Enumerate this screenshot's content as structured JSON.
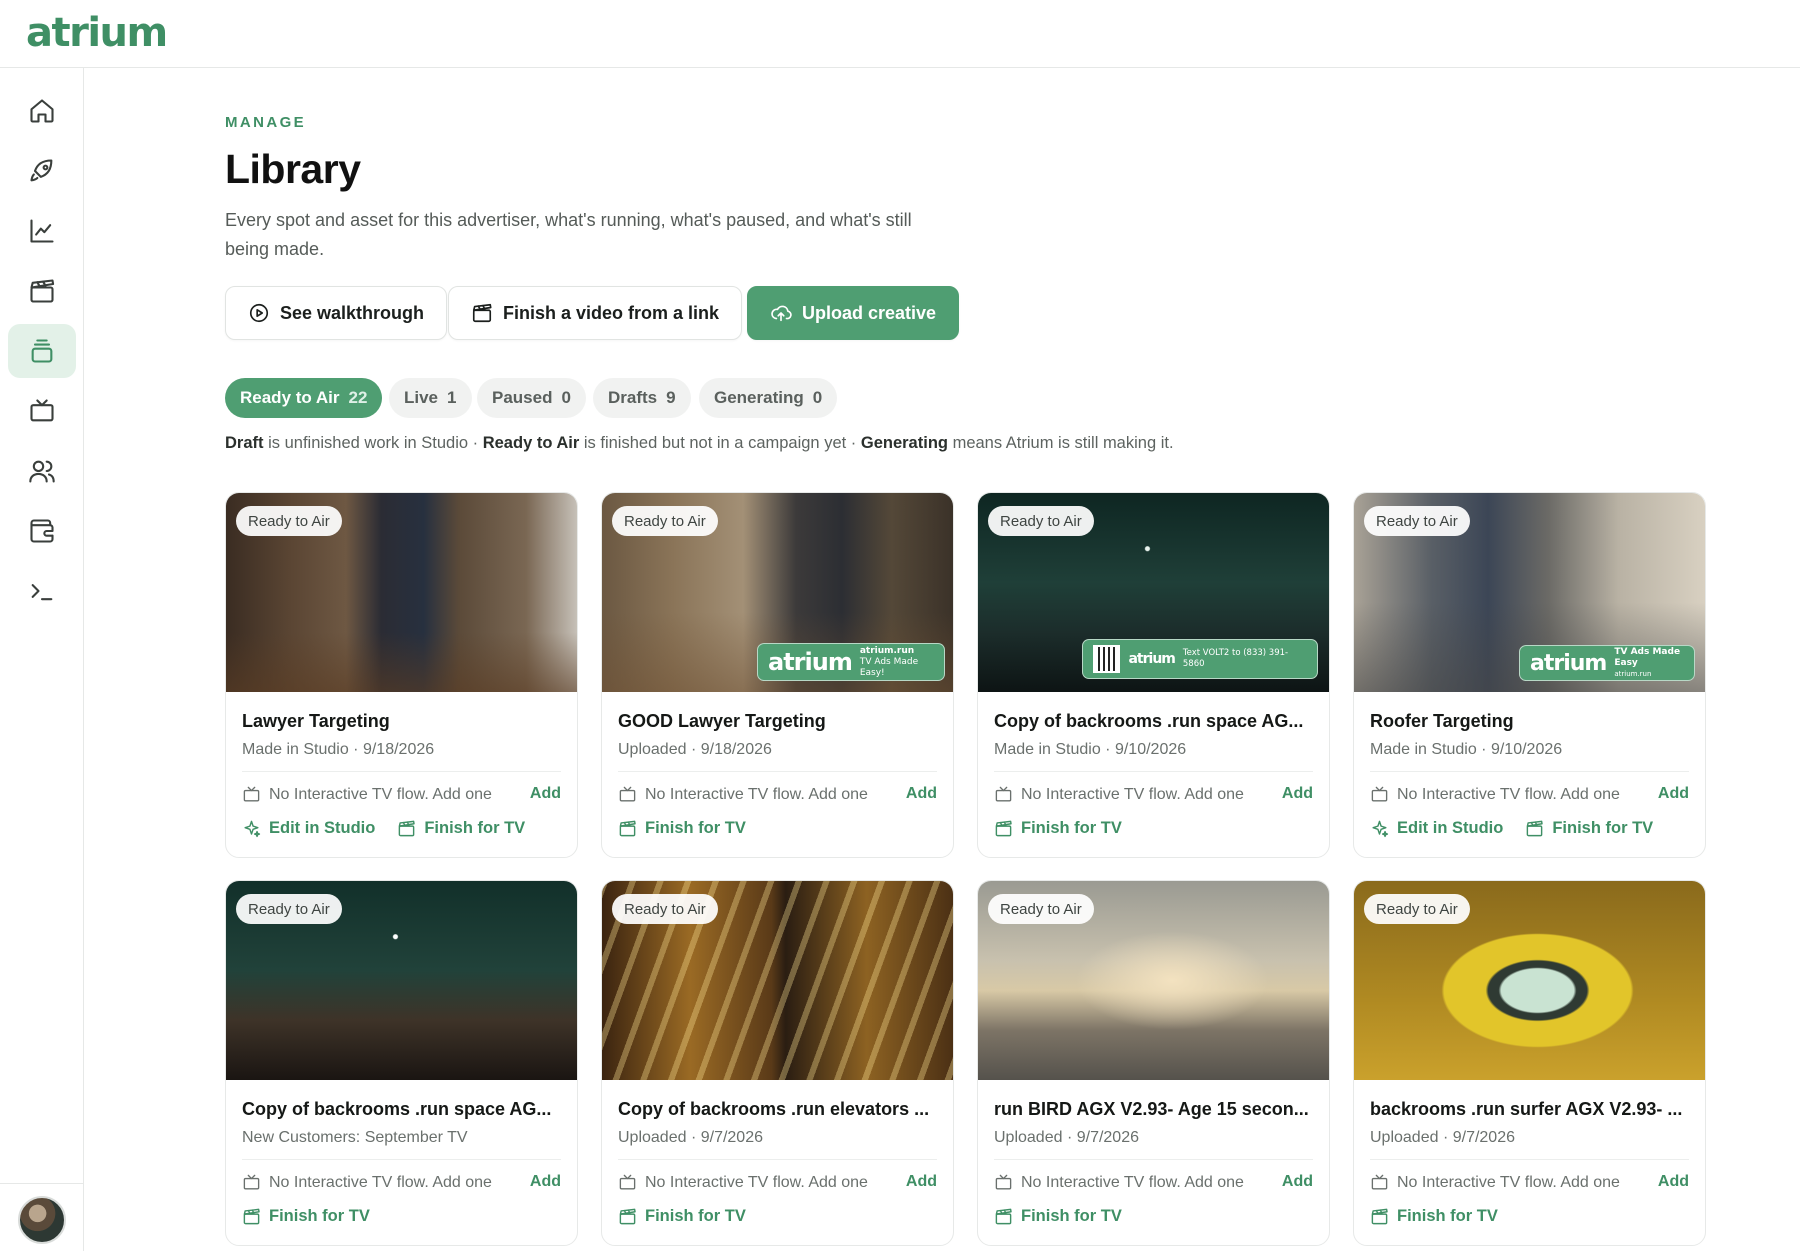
{
  "brand": {
    "logo_text": "atrium",
    "accent": "#4f9e72"
  },
  "sidebar": {
    "items": [
      {
        "icon": "home-icon",
        "active": false
      },
      {
        "icon": "rocket-icon",
        "active": false
      },
      {
        "icon": "chart-line-icon",
        "active": false
      },
      {
        "icon": "clapperboard-icon",
        "active": false
      },
      {
        "icon": "library-stack-icon",
        "active": true
      },
      {
        "icon": "tv-icon",
        "active": false
      },
      {
        "icon": "users-icon",
        "active": false
      },
      {
        "icon": "wallet-icon",
        "active": false
      },
      {
        "icon": "terminal-icon",
        "active": false
      }
    ]
  },
  "header": {
    "eyebrow": "MANAGE",
    "title": "Library",
    "description": "Every spot and asset for this advertiser, what's running, what's paused, and what's still being made."
  },
  "buttons": {
    "walkthrough": "See walkthrough",
    "finish_link": "Finish a video from a link",
    "upload": "Upload creative"
  },
  "filters": [
    {
      "label": "Ready to Air",
      "count": "22",
      "active": true
    },
    {
      "label": "Live",
      "count": "1",
      "active": false
    },
    {
      "label": "Paused",
      "count": "0",
      "active": false
    },
    {
      "label": "Drafts",
      "count": "9",
      "active": false
    },
    {
      "label": "Generating",
      "count": "0",
      "active": false
    }
  ],
  "legend": {
    "draft_term": "Draft",
    "draft_text": " is unfinished work in Studio · ",
    "ready_term": "Ready to Air",
    "ready_text": " is finished but not in a campaign yet · ",
    "generating_term": "Generating",
    "generating_text": " means Atrium is still making it."
  },
  "overlays": {
    "brand": "atrium",
    "c2_url": "atrium.run",
    "c2_tag": "TV Ads Made Easy!",
    "c3_cta": "Text VOLT2 to (833) 391-5860",
    "c4_tag": "TV Ads Made Easy",
    "c4_url": "atrium.run"
  },
  "cards": [
    {
      "badge": "Ready to Air",
      "title": "Lawyer Targeting",
      "subtitle": "Made in Studio · 9/18/2026",
      "flow": "No Interactive TV flow. Add one",
      "add": "Add",
      "actions": [
        "Edit in Studio",
        "Finish for TV"
      ]
    },
    {
      "badge": "Ready to Air",
      "title": "GOOD Lawyer Targeting",
      "subtitle": "Uploaded · 9/18/2026",
      "flow": "No Interactive TV flow. Add one",
      "add": "Add",
      "actions": [
        "Finish for TV"
      ]
    },
    {
      "badge": "Ready to Air",
      "title": "Copy of backrooms .run space AG...",
      "subtitle": "Made in Studio · 9/10/2026",
      "flow": "No Interactive TV flow. Add one",
      "add": "Add",
      "actions": [
        "Finish for TV"
      ]
    },
    {
      "badge": "Ready to Air",
      "title": "Roofer Targeting",
      "subtitle": "Made in Studio · 9/10/2026",
      "flow": "No Interactive TV flow. Add one",
      "add": "Add",
      "actions": [
        "Edit in Studio",
        "Finish for TV"
      ]
    },
    {
      "badge": "Ready to Air",
      "title": "Copy of backrooms .run space AG...",
      "subtitle": "New Customers: September TV",
      "flow": "No Interactive TV flow. Add one",
      "add": "Add",
      "actions": [
        "Finish for TV"
      ]
    },
    {
      "badge": "Ready to Air",
      "title": "Copy of backrooms .run elevators ...",
      "subtitle": "Uploaded · 9/7/2026",
      "flow": "No Interactive TV flow. Add one",
      "add": "Add",
      "actions": [
        "Finish for TV"
      ]
    },
    {
      "badge": "Ready to Air",
      "title": "run BIRD AGX V2.93- Age 15 secon...",
      "subtitle": "Uploaded · 9/7/2026",
      "flow": "No Interactive TV flow. Add one",
      "add": "Add",
      "actions": [
        "Finish for TV"
      ]
    },
    {
      "badge": "Ready to Air",
      "title": "backrooms .run surfer AGX V2.93- ...",
      "subtitle": "Uploaded · 9/7/2026",
      "flow": "No Interactive TV flow. Add one",
      "add": "Add",
      "actions": [
        "Finish for TV"
      ]
    }
  ]
}
